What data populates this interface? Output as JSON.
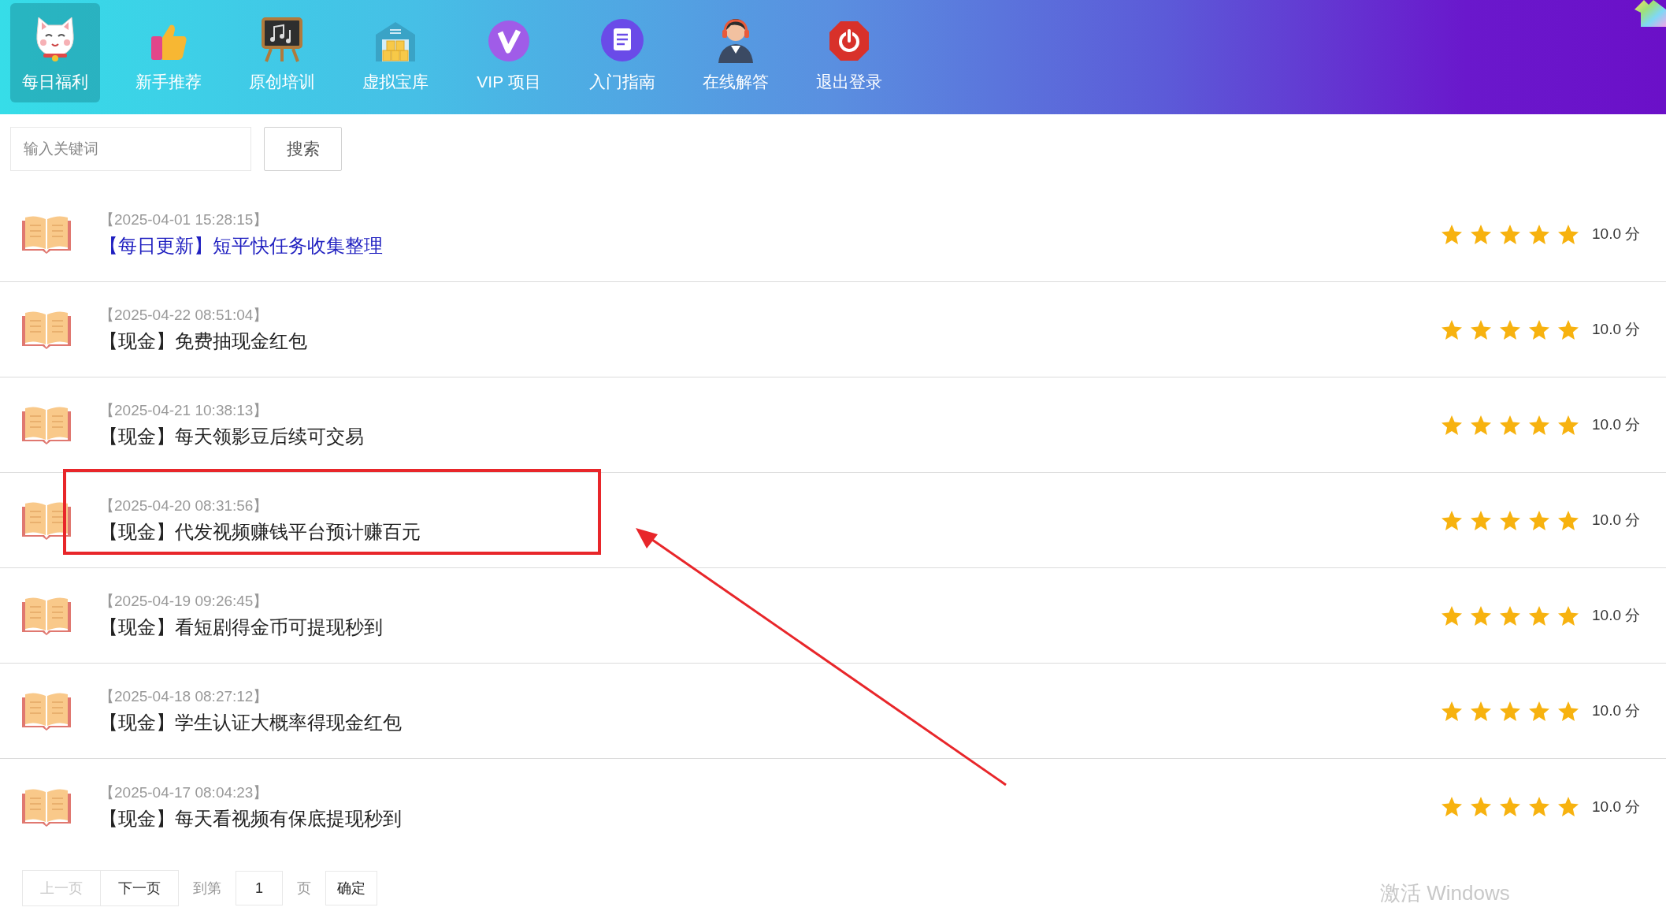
{
  "nav": {
    "items": [
      {
        "label": "每日福利",
        "selected": true
      },
      {
        "label": "新手推荐",
        "selected": false
      },
      {
        "label": "原创培训",
        "selected": false
      },
      {
        "label": "虚拟宝库",
        "selected": false
      },
      {
        "label": "VIP 项目",
        "selected": false
      },
      {
        "label": "入门指南",
        "selected": false
      },
      {
        "label": "在线解答",
        "selected": false
      },
      {
        "label": "退出登录",
        "selected": false
      }
    ]
  },
  "search": {
    "placeholder": "输入关键词",
    "button": "搜索"
  },
  "articles": [
    {
      "date": "【2025-04-01 15:28:15】",
      "title": "【每日更新】短平快任务收集整理",
      "kind": "highlighted",
      "stars": 5,
      "score": "10.0 分"
    },
    {
      "date": "【2025-04-22 08:51:04】",
      "title": "【现金】免费抽现金红包",
      "kind": "normal",
      "stars": 5,
      "score": "10.0 分"
    },
    {
      "date": "【2025-04-21 10:38:13】",
      "title": "【现金】每天领影豆后续可交易",
      "kind": "normal",
      "stars": 5,
      "score": "10.0 分"
    },
    {
      "date": "【2025-04-20 08:31:56】",
      "title": "【现金】代发视频赚钱平台预计赚百元",
      "kind": "normal",
      "stars": 5,
      "score": "10.0 分"
    },
    {
      "date": "【2025-04-19 09:26:45】",
      "title": "【现金】看短剧得金币可提现秒到",
      "kind": "normal",
      "stars": 5,
      "score": "10.0 分"
    },
    {
      "date": "【2025-04-18 08:27:12】",
      "title": "【现金】学生认证大概率得现金红包",
      "kind": "normal",
      "stars": 5,
      "score": "10.0 分"
    },
    {
      "date": "【2025-04-17 08:04:23】",
      "title": "【现金】每天看视频有保底提现秒到",
      "kind": "normal",
      "stars": 5,
      "score": "10.0 分"
    }
  ],
  "pagination": {
    "prev": {
      "label": "上一页",
      "disabled": true
    },
    "next": {
      "label": "下一页",
      "disabled": false
    },
    "goto_label": "到第",
    "page_value": "1",
    "page_unit": "页",
    "confirm": "确定"
  },
  "os_overlay": "激活 Windows"
}
